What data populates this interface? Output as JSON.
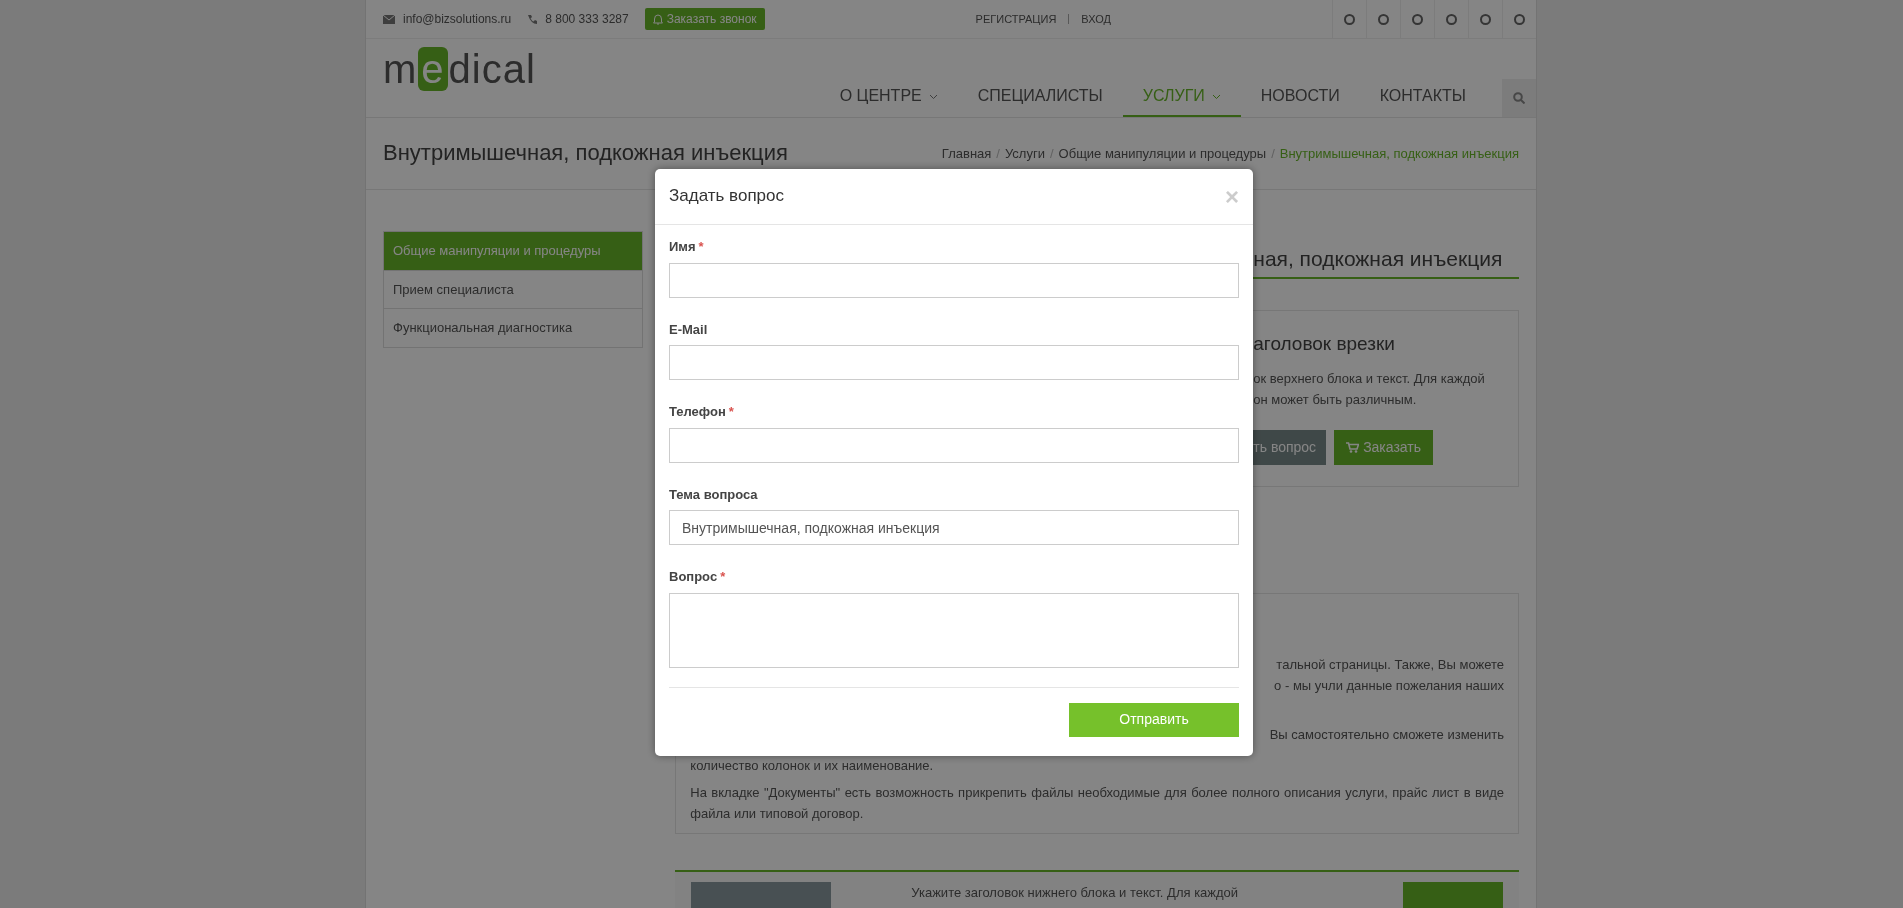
{
  "topbar": {
    "email": "info@bizsolutions.ru",
    "phone": "8 800 333 3287",
    "callback_button": "Заказать звонок",
    "auth_links": [
      "РЕГИСТРАЦИЯ",
      "ВХОД"
    ]
  },
  "logo": {
    "start": "m",
    "highlight": "e",
    "end": "dical"
  },
  "nav": [
    {
      "label": "О ЦЕНТРЕ",
      "selected": false,
      "dropdown": true
    },
    {
      "label": "СПЕЦИАЛИСТЫ",
      "selected": false,
      "dropdown": false
    },
    {
      "label": "УСЛУГИ",
      "selected": true,
      "dropdown": true
    },
    {
      "label": "НОВОСТИ",
      "selected": false,
      "dropdown": false
    },
    {
      "label": "КОНТАКТЫ",
      "selected": false,
      "dropdown": false
    }
  ],
  "page_title": "Внутримышечная, подкожная инъекция",
  "breadcrumb_separator": "/",
  "breadcrumbs": [
    {
      "label": "Главная",
      "selected": false
    },
    {
      "label": "Услуги",
      "selected": false
    },
    {
      "label": "Общие манипуляции и процедуры",
      "selected": false
    },
    {
      "label": "Внутримышечная, подкожная инъекция",
      "selected": true
    }
  ],
  "sidebar": {
    "items": [
      {
        "label": "Общие манипуляции и процедуры",
        "selected": true
      },
      {
        "label": "Прием специалиста",
        "selected": false
      },
      {
        "label": "Функциональная диагностика",
        "selected": false
      }
    ]
  },
  "content": {
    "heading": "ная, подкожная инъекция",
    "inset": {
      "title": "аголовок врезки",
      "lines": [
        "ок верхнего блока и текст. Для каждой",
        "он может быть различным."
      ],
      "ask_button": "ть вопрос",
      "order_button": "Заказать"
    },
    "description": {
      "cut_lines": [
        "тальной страницы. Также, Вы можете",
        "о - мы учли данные пожелания наших",
        "Вы самостоятельно сможете изменить"
      ],
      "paragraphs": [
        "количество колонок и их наименование.",
        "На вкладке \"Документы\"  есть возможность прикрепить файлы необходимые для более полного описания услуги, прайс лист в виде файла или типовой договор."
      ]
    },
    "bottom_block": {
      "text": "Укажите заголовок нижнего блока и текст. Для каждой"
    }
  },
  "modal": {
    "title": "Задать вопрос",
    "close": "×",
    "fields": [
      {
        "kind": "input",
        "label": "Имя",
        "required_mark": "*"
      },
      {
        "kind": "input",
        "label": "E-Mail"
      },
      {
        "kind": "input",
        "label": "Телефон",
        "required_mark": "*"
      },
      {
        "kind": "input",
        "label": "Тема вопроса",
        "value": "Внутримышечная, подкожная инъекция"
      },
      {
        "kind": "textarea",
        "label": "Вопрос",
        "required_mark": "*"
      }
    ],
    "submit": "Отправить"
  }
}
